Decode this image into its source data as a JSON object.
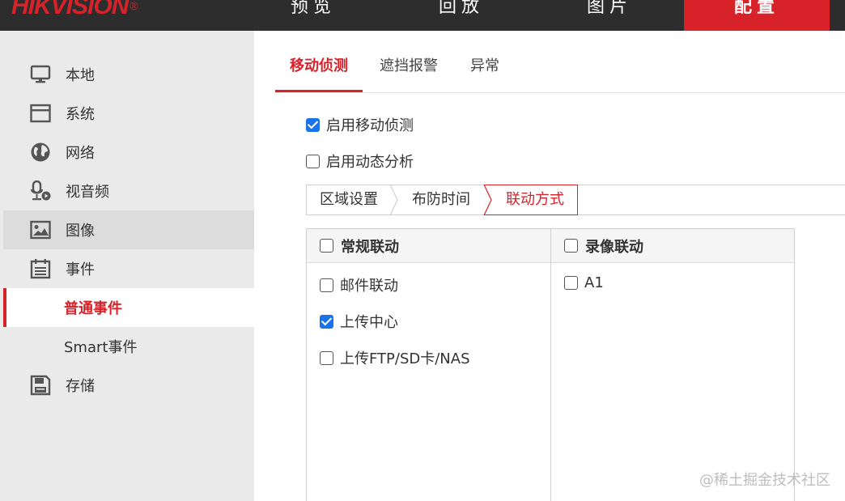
{
  "header": {
    "logo": "HIKVISION",
    "logo_reg": "®",
    "nav": [
      "预览",
      "回放",
      "图片",
      "配置"
    ],
    "active_nav": "配置",
    "accent": "#d7222a"
  },
  "sidebar": {
    "items": [
      {
        "label": "本地",
        "icon": "monitor-icon"
      },
      {
        "label": "系统",
        "icon": "window-icon"
      },
      {
        "label": "网络",
        "icon": "globe-icon"
      },
      {
        "label": "视音频",
        "icon": "microphone-video-icon"
      },
      {
        "label": "图像",
        "icon": "image-icon"
      },
      {
        "label": "事件",
        "icon": "calendar-icon"
      }
    ],
    "sub_items": [
      "普通事件",
      "Smart事件"
    ],
    "storage": {
      "label": "存储",
      "icon": "floppy-disk-icon"
    }
  },
  "tabs": [
    "移动侦测",
    "遮挡报警",
    "异常"
  ],
  "options": [
    {
      "label": "启用移动侦测",
      "checked": true
    },
    {
      "label": "启用动态分析",
      "checked": false
    }
  ],
  "steps": [
    "区域设置",
    "布防时间",
    "联动方式"
  ],
  "linkage": {
    "normal": {
      "header": "常规联动",
      "items": [
        {
          "label": "邮件联动",
          "checked": false
        },
        {
          "label": "上传中心",
          "checked": true
        },
        {
          "label": "上传FTP/SD卡/NAS",
          "checked": false
        }
      ]
    },
    "record": {
      "header": "录像联动",
      "items": [
        {
          "label": "A1",
          "checked": false
        }
      ]
    }
  },
  "watermark": "@稀土掘金技术社区"
}
